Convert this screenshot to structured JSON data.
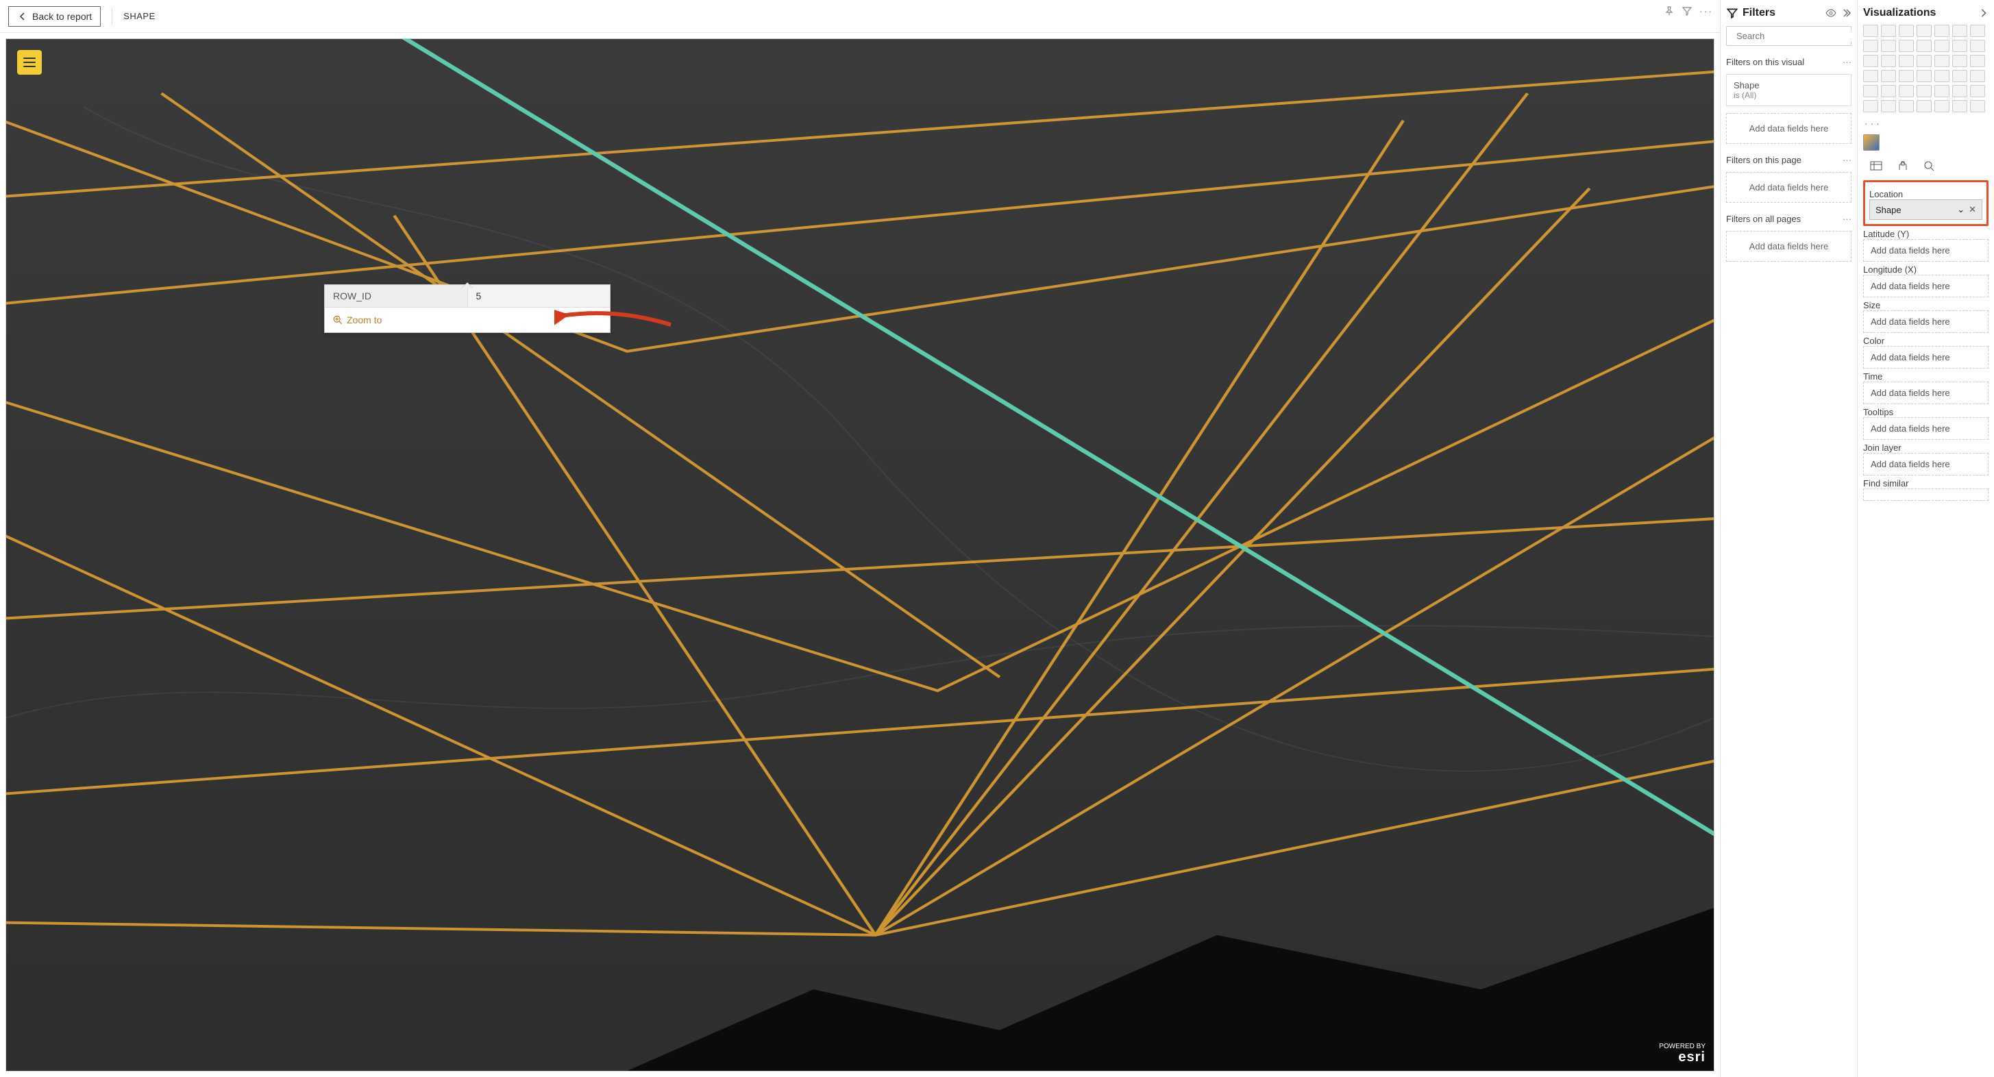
{
  "topbar": {
    "back_label": "Back to report",
    "title": "SHAPE"
  },
  "map": {
    "callout": {
      "key": "ROW_ID",
      "value": "5",
      "zoom_label": "Zoom to"
    },
    "attribution_prefix": "POWERED BY",
    "attribution_brand": "esri"
  },
  "filters": {
    "title": "Filters",
    "search_placeholder": "Search",
    "sections": {
      "visual": {
        "label": "Filters on this visual",
        "card_field": "Shape",
        "card_condition": "is (All)",
        "add_label": "Add data fields here"
      },
      "page": {
        "label": "Filters on this page",
        "add_label": "Add data fields here"
      },
      "all": {
        "label": "Filters on all pages",
        "add_label": "Add data fields here"
      }
    }
  },
  "viz": {
    "title": "Visualizations",
    "wells": [
      {
        "label": "Location",
        "pill": "Shape",
        "highlighted": true
      },
      {
        "label": "Latitude (Y)",
        "placeholder": "Add data fields here"
      },
      {
        "label": "Longitude (X)",
        "placeholder": "Add data fields here"
      },
      {
        "label": "Size",
        "placeholder": "Add data fields here"
      },
      {
        "label": "Color",
        "placeholder": "Add data fields here"
      },
      {
        "label": "Time",
        "placeholder": "Add data fields here"
      },
      {
        "label": "Tooltips",
        "placeholder": "Add data fields here"
      },
      {
        "label": "Join layer",
        "placeholder": "Add data fields here"
      },
      {
        "label": "Find similar",
        "placeholder": ""
      }
    ]
  }
}
